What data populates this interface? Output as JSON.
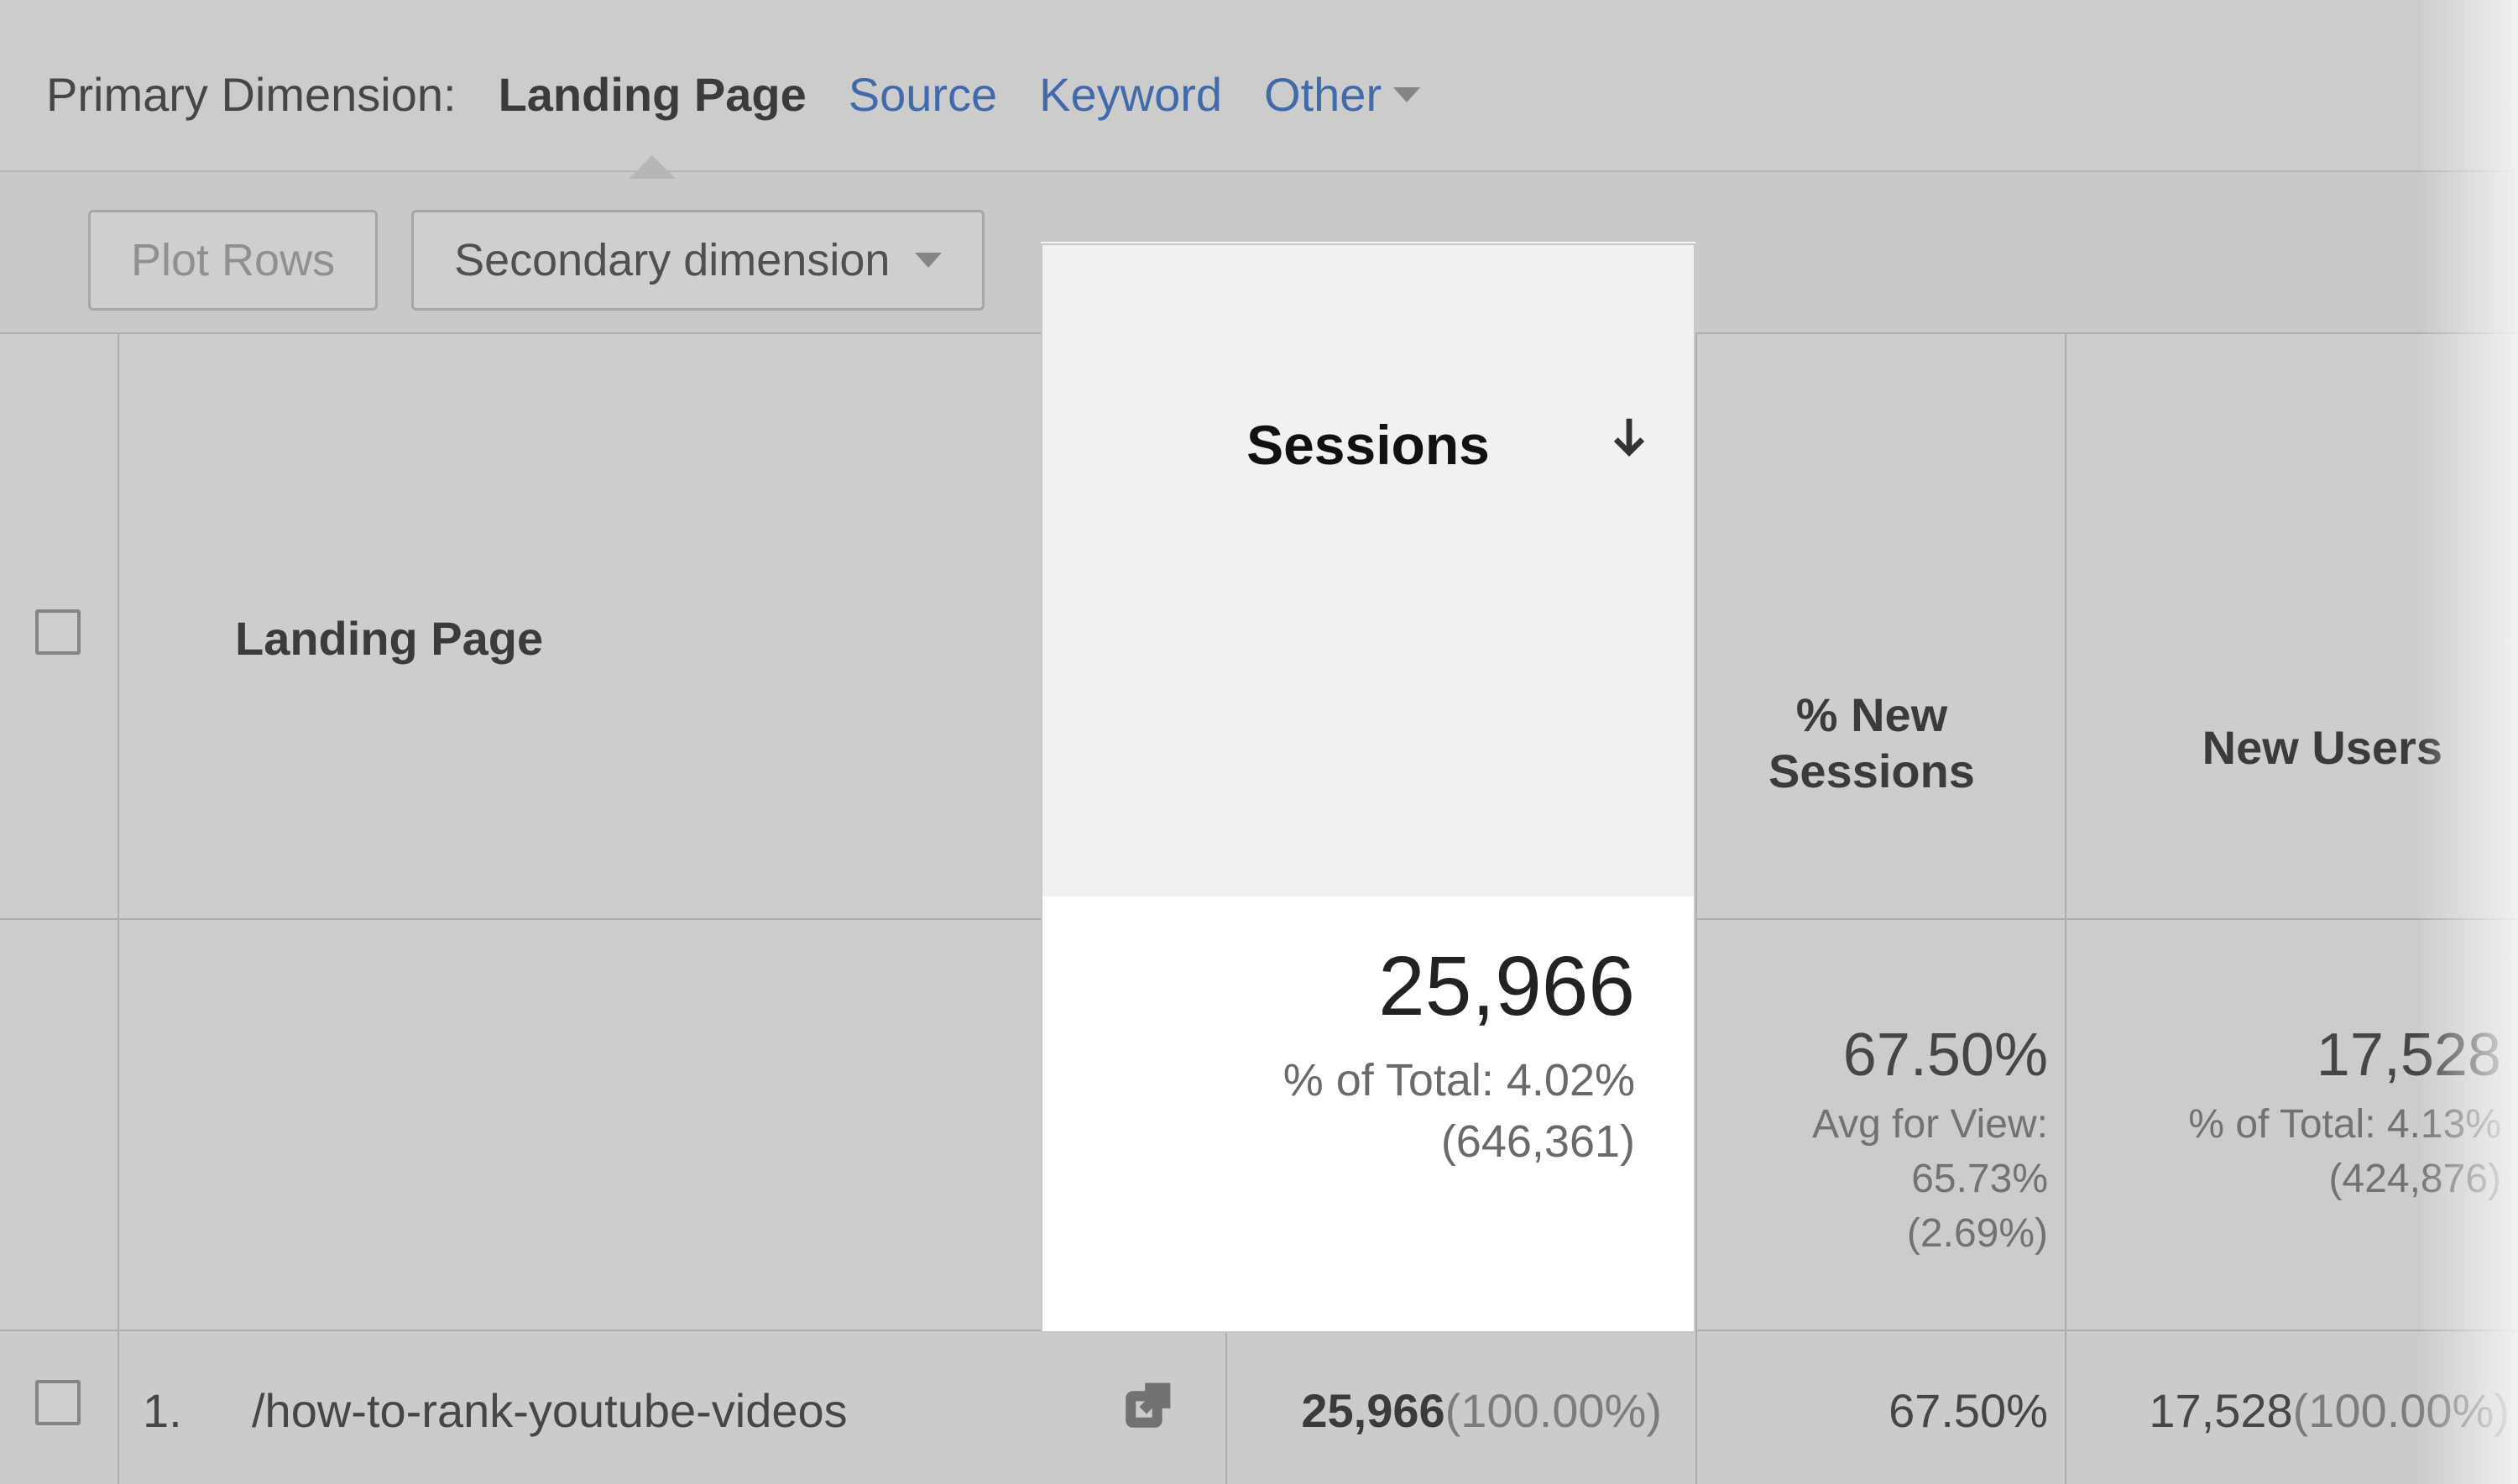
{
  "dimensions": {
    "label": "Primary Dimension:",
    "active": "Landing Page",
    "links": [
      "Source",
      "Keyword"
    ],
    "other": "Other"
  },
  "controls": {
    "plot_rows": "Plot Rows",
    "secondary_dimension": "Secondary dimension"
  },
  "table": {
    "headers": {
      "landing_page": "Landing Page",
      "sessions": "Sessions",
      "pct_new_sessions": "% New Sessions",
      "new_users": "New Users"
    },
    "summary": {
      "sessions": {
        "value": "25,966",
        "sub1": "% of Total: 4.02%",
        "sub2": "(646,361)"
      },
      "pct_new_sessions": {
        "value": "67.50%",
        "sub1": "Avg for View:",
        "sub2": "65.73%",
        "sub3": "(2.69%)"
      },
      "new_users": {
        "value": "17,528",
        "sub1": "% of Total: 4.13%",
        "sub2": "(424,876)"
      }
    },
    "rows": [
      {
        "index": "1.",
        "path": "/how-to-rank-youtube-videos",
        "sessions": "25,966",
        "sessions_pct": "(100.00%)",
        "pct_new_sessions": "67.50%",
        "new_users": "17,528",
        "new_users_pct": "(100.00%)"
      }
    ]
  }
}
